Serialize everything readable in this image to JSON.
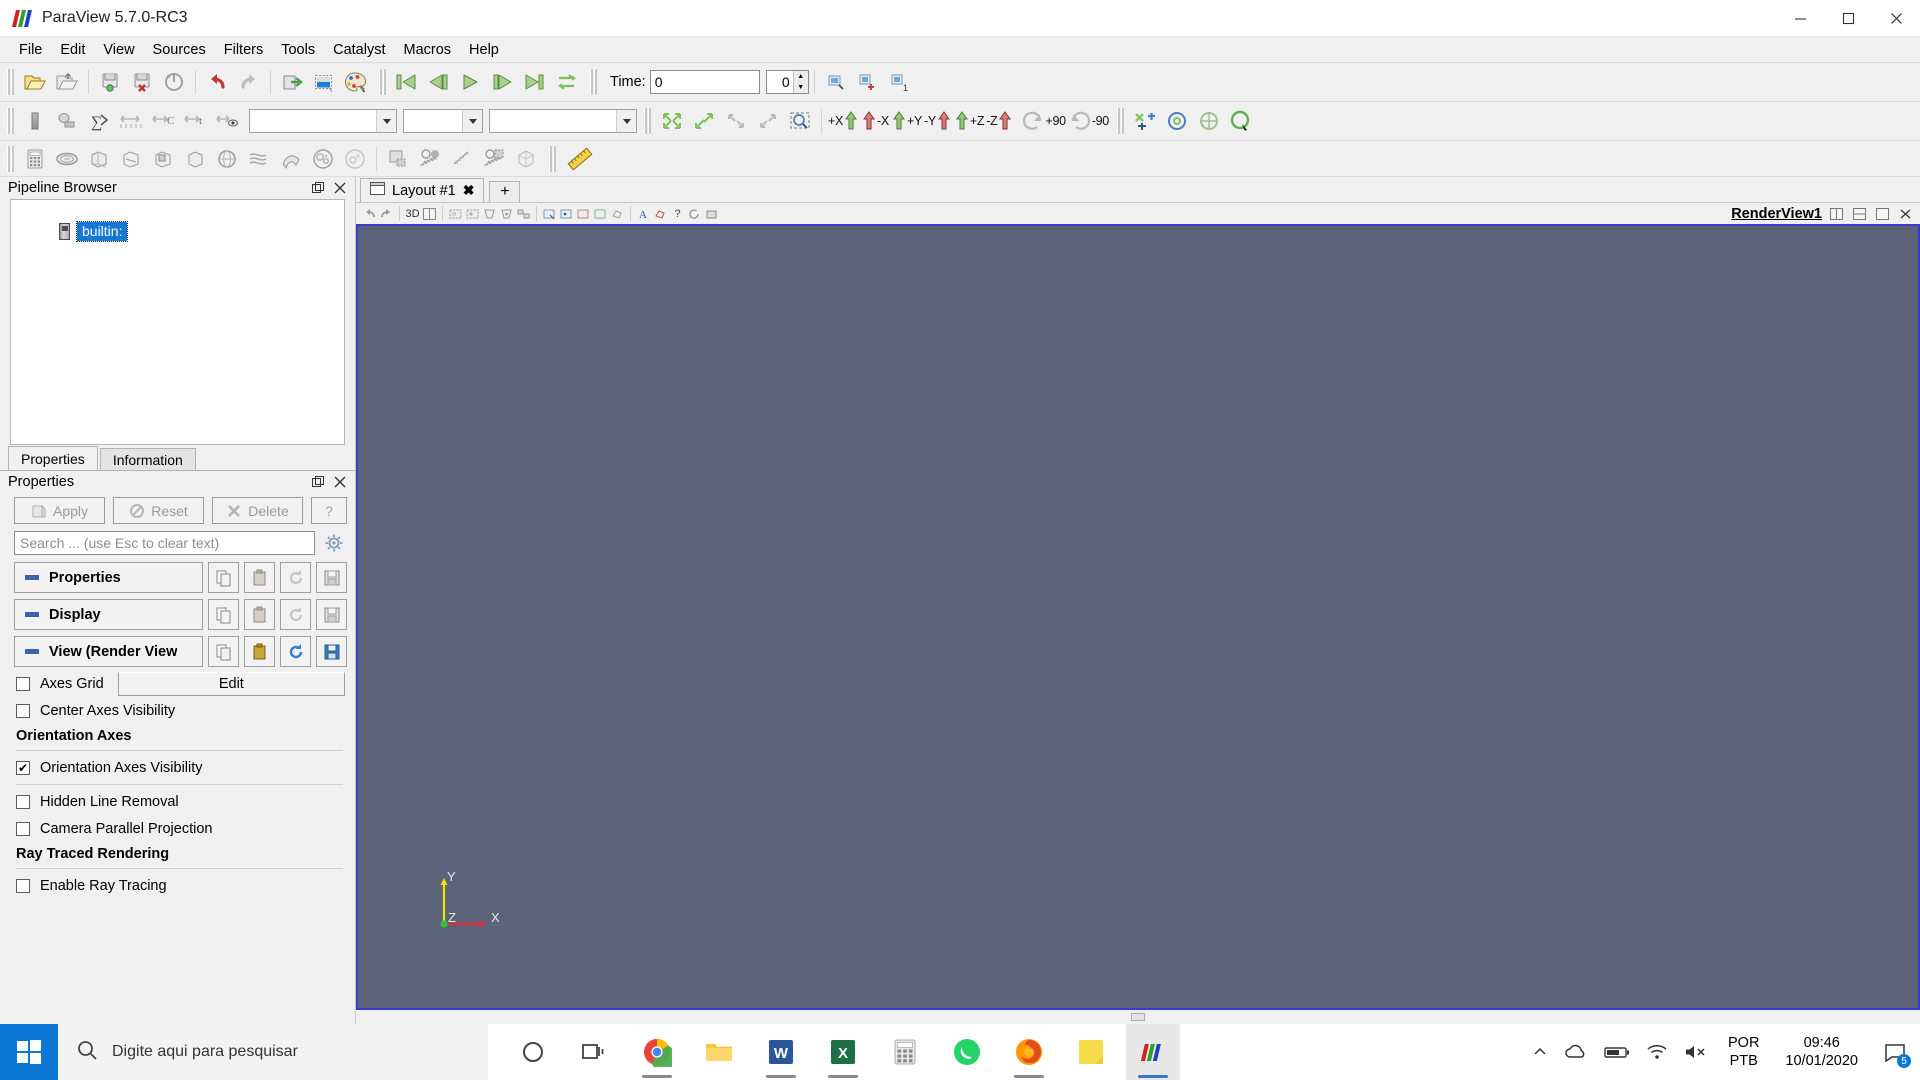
{
  "window": {
    "title": "ParaView 5.7.0-RC3",
    "logo_colors": [
      "#d02020",
      "#2fa02f",
      "#2040c0"
    ],
    "controls": {
      "minimize": "minimize-icon",
      "maximize": "maximize-icon",
      "close": "close-icon"
    }
  },
  "menubar": {
    "items": [
      "File",
      "Edit",
      "View",
      "Sources",
      "Filters",
      "Tools",
      "Catalyst",
      "Macros",
      "Help"
    ]
  },
  "toolbars": {
    "main": [
      {
        "name": "open-file",
        "tip": "Open"
      },
      {
        "name": "recent-files",
        "tip": "Recent Files"
      },
      {
        "name": "save-state",
        "tip": "Save State"
      },
      {
        "name": "load-state",
        "tip": "Load State"
      },
      {
        "name": "reset-session",
        "tip": "Reset Session"
      },
      {
        "name": "undo",
        "tip": "Undo"
      },
      {
        "name": "redo",
        "tip": "Redo"
      },
      {
        "name": "connect-server",
        "tip": "Connect"
      },
      {
        "name": "capture-screenshot",
        "tip": "Capture Screenshot"
      },
      {
        "name": "edit-color-map",
        "tip": "Edit Color Map"
      }
    ],
    "vcr": [
      {
        "name": "first-frame",
        "tip": "First Frame"
      },
      {
        "name": "previous-frame",
        "tip": "Previous Frame"
      },
      {
        "name": "play",
        "tip": "Play"
      },
      {
        "name": "next-frame",
        "tip": "Next Frame"
      },
      {
        "name": "last-frame",
        "tip": "Last Frame"
      },
      {
        "name": "loop",
        "tip": "Loop"
      }
    ],
    "time": {
      "label": "Time:",
      "value": "0",
      "frame_value": "0",
      "max_frames": "1"
    },
    "vcr_extra": [
      {
        "name": "view-time-inspector",
        "tip": "Time Inspector"
      },
      {
        "name": "add-time-step",
        "tip": "Add Time Step"
      },
      {
        "name": "remove-time-step",
        "tip": "Remove Time Step"
      }
    ],
    "representation": [
      {
        "name": "show-color-legend",
        "tip": "Toggle Color Legend Visibility"
      },
      {
        "name": "edit-color-legend",
        "tip": "Edit Color Legend"
      },
      {
        "name": "rescale-to-data-range",
        "tip": "Rescale To Data Range"
      },
      {
        "name": "rescale-to-custom-range",
        "tip": "Rescale To Custom Data Range"
      },
      {
        "name": "rescale-to-visible-range",
        "tip": "Rescale To Visible Range"
      },
      {
        "name": "rescale-over-time",
        "tip": "Rescale To Temporal Range"
      },
      {
        "name": "rescale-to-data-range-over-time",
        "tip": "Rescale Over Time"
      }
    ],
    "combos": [
      {
        "name": "array-selector",
        "value": ""
      },
      {
        "name": "representation-selector",
        "value": ""
      },
      {
        "name": "view-selector",
        "value": ""
      }
    ],
    "camera": [
      {
        "name": "reset-camera",
        "tip": "Reset"
      },
      {
        "name": "zoom-to-data",
        "tip": "Zoom To Data"
      },
      {
        "name": "reset-camera-closest",
        "tip": "Reset Camera Closest"
      },
      {
        "name": "zoom-closest-to-data",
        "tip": "Zoom Closest To Data"
      },
      {
        "name": "zoom-to-box",
        "tip": "Zoom To Box"
      }
    ],
    "axis_buttons": [
      {
        "name": "set-view-plus-x",
        "label": "+X",
        "color": "#3a9b3a"
      },
      {
        "name": "set-view-minus-x",
        "label": "-X",
        "color": "#c02020"
      },
      {
        "name": "set-view-plus-y",
        "label": "+Y",
        "color": "#3a9b3a"
      },
      {
        "name": "set-view-minus-y",
        "label": "-Y",
        "color": "#c02020"
      },
      {
        "name": "set-view-plus-z",
        "label": "+Z",
        "color": "#3a9b3a"
      },
      {
        "name": "set-view-minus-z",
        "label": "-Z",
        "color": "#c02020"
      }
    ],
    "rotate_buttons": [
      {
        "name": "rotate-plus-90",
        "label": "+90"
      },
      {
        "name": "rotate-minus-90",
        "label": "-90"
      }
    ],
    "center_axes": [
      {
        "name": "show-center",
        "tip": "Show Center"
      },
      {
        "name": "pick-center",
        "tip": "Pick Center"
      },
      {
        "name": "reset-center",
        "tip": "Reset Center"
      },
      {
        "name": "rotation-center-cursor",
        "tip": "Rotation Center / Cursor"
      }
    ],
    "sources": [
      {
        "name": "calculator-filter",
        "tip": "Calculator"
      },
      {
        "name": "contour-filter",
        "tip": "Contour"
      },
      {
        "name": "clip-filter",
        "tip": "Clip"
      },
      {
        "name": "slice-filter",
        "tip": "Slice"
      },
      {
        "name": "threshold-filter",
        "tip": "Threshold"
      },
      {
        "name": "extract-subset-filter",
        "tip": "Extract Subset"
      },
      {
        "name": "glyph-filter",
        "tip": "Glyph"
      },
      {
        "name": "stream-tracer-filter",
        "tip": "Stream Tracer"
      },
      {
        "name": "warp-filter",
        "tip": "Warp By Vector"
      },
      {
        "name": "group-datasets-filter",
        "tip": "Group Datasets"
      },
      {
        "name": "extract-level-filter",
        "tip": "Extract Level"
      }
    ],
    "plots": [
      {
        "name": "plot-data",
        "tip": "Plot Data"
      },
      {
        "name": "plot-over-time",
        "tip": "Plot Data Over Time"
      },
      {
        "name": "plot-over-line",
        "tip": "Plot Over Line"
      },
      {
        "name": "plot-selection-over-time",
        "tip": "Plot Selection Over Time"
      },
      {
        "name": "extract-block",
        "tip": "Extract Block"
      }
    ],
    "measure": [
      {
        "name": "ruler-tool",
        "tip": "Ruler"
      }
    ]
  },
  "pipeline_browser": {
    "title": "Pipeline Browser",
    "undock_icon": "undock-icon",
    "close_icon": "close-icon",
    "items": [
      {
        "name": "builtin-server",
        "label": "builtin:",
        "selected": true,
        "icon": "server-icon"
      }
    ]
  },
  "properties_panel": {
    "tabs": [
      {
        "name": "tab-properties",
        "label": "Properties",
        "active": true
      },
      {
        "name": "tab-information",
        "label": "Information",
        "active": false
      }
    ],
    "title": "Properties",
    "undock_icon": "undock-icon",
    "close_icon": "close-icon",
    "action_buttons": [
      {
        "name": "apply-button",
        "label": "Apply",
        "icon": "apply-icon",
        "enabled": false
      },
      {
        "name": "reset-button",
        "label": "Reset",
        "icon": "reset-icon",
        "enabled": false
      },
      {
        "name": "delete-button",
        "label": "Delete",
        "icon": "delete-icon",
        "enabled": false
      },
      {
        "name": "help-button",
        "label": "?",
        "icon": "help-icon",
        "enabled": false
      }
    ],
    "search": {
      "placeholder": "Search ... (use Esc to clear text)",
      "value": "",
      "gear_icon": "gear-icon"
    },
    "sections": [
      {
        "name": "section-properties",
        "label": "Properties",
        "buttons": [
          "copy-icon",
          "paste-icon",
          "restore-defaults-icon",
          "save-defaults-icon"
        ]
      },
      {
        "name": "section-display",
        "label": "Display",
        "buttons": [
          "copy-icon",
          "paste-icon",
          "restore-defaults-icon",
          "save-defaults-icon"
        ]
      },
      {
        "name": "section-view",
        "label": "View (Render View",
        "buttons": [
          "copy-icon",
          "paste-icon",
          "restore-defaults-icon",
          "save-defaults-icon"
        ]
      }
    ],
    "view_options": [
      {
        "name": "axes-grid-checkbox",
        "label": "Axes Grid",
        "checked": false,
        "edit_label": "Edit"
      },
      {
        "name": "center-axes-visibility-checkbox",
        "label": "Center Axes Visibility",
        "checked": false
      }
    ],
    "orientation_group": {
      "header": "Orientation Axes",
      "options": [
        {
          "name": "orientation-axes-visibility-checkbox",
          "label": "Orientation Axes Visibility",
          "checked": true
        }
      ]
    },
    "misc_options": [
      {
        "name": "hidden-line-removal-checkbox",
        "label": "Hidden Line Removal",
        "checked": false
      },
      {
        "name": "camera-parallel-projection-checkbox",
        "label": "Camera Parallel Projection",
        "checked": false
      }
    ],
    "ray_group": {
      "header": "Ray Traced Rendering",
      "options": [
        {
          "name": "enable-ray-tracing-checkbox",
          "label": "Enable Ray Tracing",
          "checked": false
        }
      ]
    }
  },
  "layout": {
    "tabs": [
      {
        "name": "layout-tab-1",
        "label": "Layout #1",
        "close": "✖",
        "icon": "layout-icon"
      }
    ],
    "add_tab_label": "+"
  },
  "render_view": {
    "name": "RenderView1",
    "background_color": "#5c6378",
    "border_color": "#3a3ad0",
    "toolbar_buttons": [
      {
        "name": "undo-camera-icon"
      },
      {
        "name": "redo-camera-icon"
      },
      {
        "name": "camera-mode-3d",
        "label": "3D"
      },
      {
        "name": "split-horizontal-icon"
      },
      {
        "name": "select-surface-cells-icon"
      },
      {
        "name": "select-surface-points-icon"
      },
      {
        "name": "select-frustum-cells-icon"
      },
      {
        "name": "select-frustum-points-icon"
      },
      {
        "name": "select-blocks-icon"
      },
      {
        "name": "interactive-select-cells-icon"
      },
      {
        "name": "interactive-select-points-icon"
      },
      {
        "name": "hover-cells-icon"
      },
      {
        "name": "hover-points-icon"
      },
      {
        "name": "select-polygon-cells-icon"
      },
      {
        "name": "edit-text-icon"
      },
      {
        "name": "help-icon"
      },
      {
        "name": "reset-icon"
      },
      {
        "name": "camera-link-icon"
      }
    ],
    "window_buttons": [
      {
        "name": "split-horizontal-button"
      },
      {
        "name": "split-vertical-button"
      },
      {
        "name": "maximize-view-button"
      },
      {
        "name": "close-view-button"
      }
    ],
    "orientation_axes": {
      "x": {
        "label": "X",
        "color": "#e03030"
      },
      "y": {
        "label": "Y",
        "color": "#e8e800"
      },
      "z": {
        "label": "Z",
        "color": "#30c030"
      }
    }
  },
  "taskbar": {
    "start": "windows-start-icon",
    "search_placeholder": "Digite aqui para pesquisar",
    "search_icon": "search-icon",
    "items": [
      {
        "name": "cortana-icon"
      },
      {
        "name": "task-view-icon"
      },
      {
        "name": "chrome-icon",
        "active": false
      },
      {
        "name": "file-explorer-icon",
        "active": false
      },
      {
        "name": "word-icon",
        "active": false
      },
      {
        "name": "excel-icon",
        "active": false
      },
      {
        "name": "calculator-icon",
        "active": false
      },
      {
        "name": "whatsapp-icon",
        "active": false
      },
      {
        "name": "firefox-icon",
        "active": false
      },
      {
        "name": "sticky-notes-icon",
        "active": false
      },
      {
        "name": "paraview-icon",
        "active": true
      }
    ],
    "tray": [
      {
        "name": "show-hidden-icons-chevron"
      },
      {
        "name": "onedrive-cloud-icon"
      },
      {
        "name": "battery-icon"
      },
      {
        "name": "wifi-icon"
      },
      {
        "name": "volume-muted-icon"
      }
    ],
    "language": {
      "line1": "POR",
      "line2": "PTB"
    },
    "clock": {
      "time": "09:46",
      "date": "10/01/2020"
    },
    "notifications": {
      "icon": "action-center-icon",
      "count": "5"
    }
  }
}
